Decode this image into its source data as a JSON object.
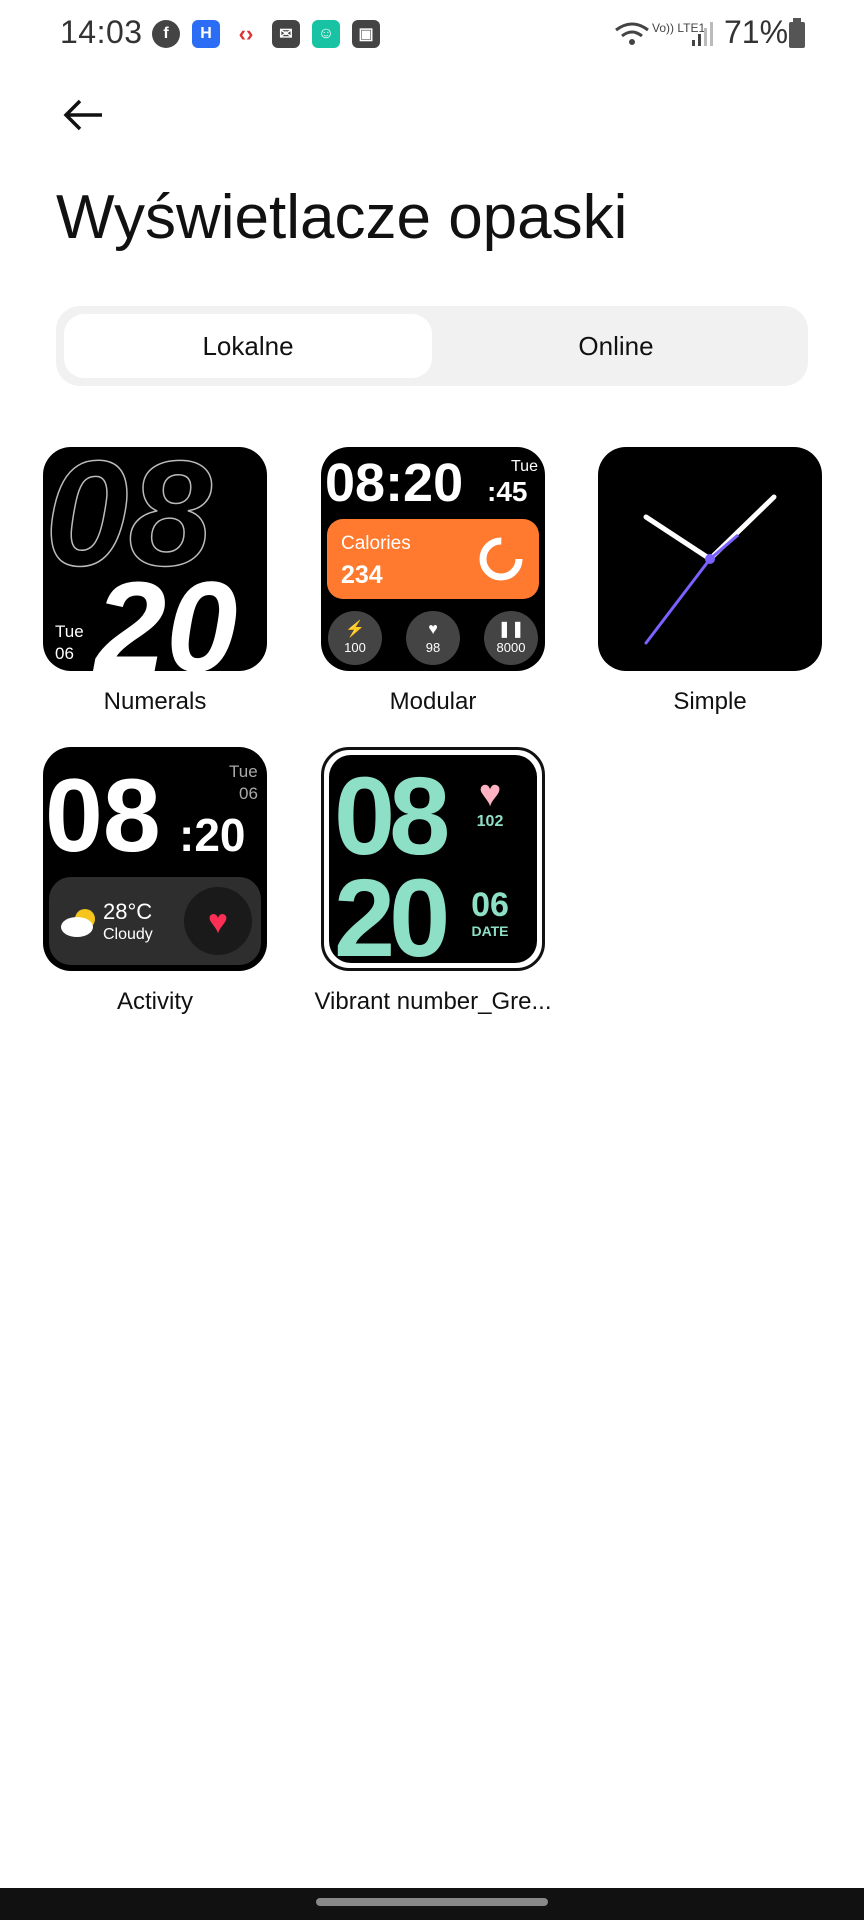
{
  "status": {
    "time": "14:03",
    "icons": [
      "facebook-icon",
      "mi-app-icon",
      "carrefour-icon",
      "mail-icon",
      "mi-fitness-icon",
      "gallery-icon"
    ],
    "network": "Vo)) LTE1",
    "battery": "71%"
  },
  "page": {
    "title": "Wyświetlacze opaski"
  },
  "tabs": [
    {
      "label": "Lokalne",
      "active": true
    },
    {
      "label": "Online",
      "active": false
    }
  ],
  "faces": [
    {
      "name": "Numerals",
      "hour": "08",
      "minute": "20",
      "day": "Tue",
      "date": "06"
    },
    {
      "name": "Modular",
      "time": "08:20",
      "seconds": ":45",
      "day": "Tue",
      "calories_label": "Calories",
      "calories_value": "234",
      "stats": [
        "100",
        "98",
        "8000"
      ],
      "accent": "#ff7a2e"
    },
    {
      "name": "Simple",
      "accent": "#7b61ff"
    },
    {
      "name": "Activity",
      "time": "08",
      "minute": ":20",
      "day": "Tue",
      "date": "06",
      "temp": "28°C",
      "weather": "Cloudy"
    },
    {
      "name": "Vibrant number_Gre...",
      "hour": "08",
      "minute": "20",
      "heart": "102",
      "date": "06",
      "date_label": "DATE",
      "accent": "#8de0c6"
    }
  ]
}
